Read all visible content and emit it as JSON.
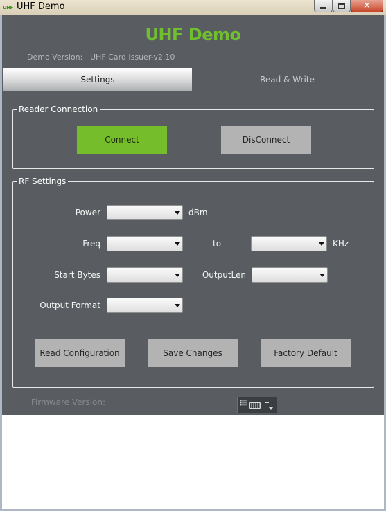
{
  "window": {
    "title": "UHF Demo",
    "icon_text": "UHF",
    "minimize": "minimize",
    "maximize": "maximize",
    "close": "close"
  },
  "header": {
    "app_title": "UHF Demo",
    "version_label": "Demo Version:",
    "version_value": "UHF Card Issuer-v2.10"
  },
  "tabs": [
    {
      "label": "Settings",
      "active": true
    },
    {
      "label": "Read & Write",
      "active": false
    }
  ],
  "reader_connection": {
    "legend": "Reader Connection",
    "connect_label": "Connect",
    "disconnect_label": "DisConnect"
  },
  "rf_settings": {
    "legend": "RF Settings",
    "power_label": "Power",
    "power_unit": "dBm",
    "freq_label": "Freq",
    "freq_to": "to",
    "freq_unit": "KHz",
    "start_bytes_label": "Start Bytes",
    "output_len_label": "OutputLen",
    "output_format_label": "Output Format",
    "read_config_label": "Read Configuration",
    "save_changes_label": "Save Changes",
    "factory_default_label": "Factory Default"
  },
  "footer": {
    "firmware_label": "Firmware Version:"
  },
  "colors": {
    "panel": "#595d61",
    "accent_green": "#76bd2b",
    "title_green": "#6fbf2e",
    "button_gray": "#b3b3b3"
  }
}
